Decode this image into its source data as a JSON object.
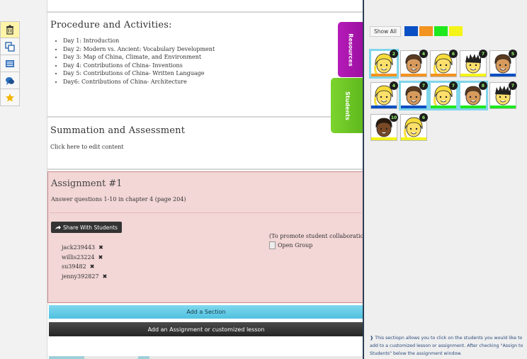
{
  "toolbar": {
    "items": [
      {
        "icon": "trash-icon"
      },
      {
        "icon": "copy-icon"
      },
      {
        "icon": "list-icon"
      },
      {
        "icon": "chat-icon"
      },
      {
        "icon": "star-icon"
      }
    ]
  },
  "procedure": {
    "title": "Procedure and Activities:",
    "items": [
      "Day 1: Introduction",
      "Day 2: Modern vs. Ancient: Vocabulary Development",
      "Day 3: Map of China, Climate, and Environment",
      "Day 4: Contributions of China- Inventions",
      "Day 5: Contributions of China- Written Language",
      "Day6: Contributions of China- Architecture"
    ]
  },
  "summation": {
    "title": "Summation and Assessment",
    "edit_text": "Click here to edit content"
  },
  "assignment": {
    "title": "Assignment #1",
    "description": "Answer questions 1-10 in chapter 4 (page 204)",
    "share_label": "Share With Students",
    "students": [
      "jack239443",
      "willis23224",
      "su39482",
      "jenny392827"
    ],
    "promote_text": "(To promote student collaboratio",
    "open_group_label": "Open Group"
  },
  "actions": {
    "add_section": "Add a Section",
    "add_assignment": "Add an Assignment or customized lesson"
  },
  "tabs": {
    "resources": "Resources",
    "students": "Students"
  },
  "panel": {
    "show_all": "Show All",
    "filter_colors": [
      "#0b4fc4",
      "#f39321",
      "#1ee81e",
      "#f4f41a"
    ],
    "students": [
      {
        "badge": "2",
        "color": "#f39321",
        "hair": "blonde",
        "selected": true
      },
      {
        "badge": "4",
        "color": "#f39321",
        "hair": "brown",
        "selected": false
      },
      {
        "badge": "6",
        "color": "#f39321",
        "hair": "blonde",
        "selected": false
      },
      {
        "badge": "7",
        "color": "#f4f41a",
        "hair": "spiky",
        "selected": false
      },
      {
        "badge": "5",
        "color": "#0b4fc4",
        "hair": "brown",
        "selected": false
      },
      {
        "badge": "4",
        "color": "#0b4fc4",
        "hair": "blonde",
        "selected": false
      },
      {
        "badge": "7",
        "color": "#0b4fc4",
        "hair": "brown",
        "selected": true
      },
      {
        "badge": "7",
        "color": "#1ee81e",
        "hair": "blonde",
        "selected": true
      },
      {
        "badge": "8",
        "color": "#1ee81e",
        "hair": "brown",
        "selected": true
      },
      {
        "badge": "7",
        "color": "#1ee81e",
        "hair": "spiky",
        "selected": false
      },
      {
        "badge": "10",
        "color": "#f4f41a",
        "hair": "dark",
        "selected": false
      },
      {
        "badge": "6",
        "color": "#f4f41a",
        "hair": "blonde",
        "selected": false
      }
    ],
    "info_text": "❱ This sectiopn allows you to click on the students you would like to add to a customized lesson or assignment. After checking \"Assign to Students\" below the assignment window."
  }
}
